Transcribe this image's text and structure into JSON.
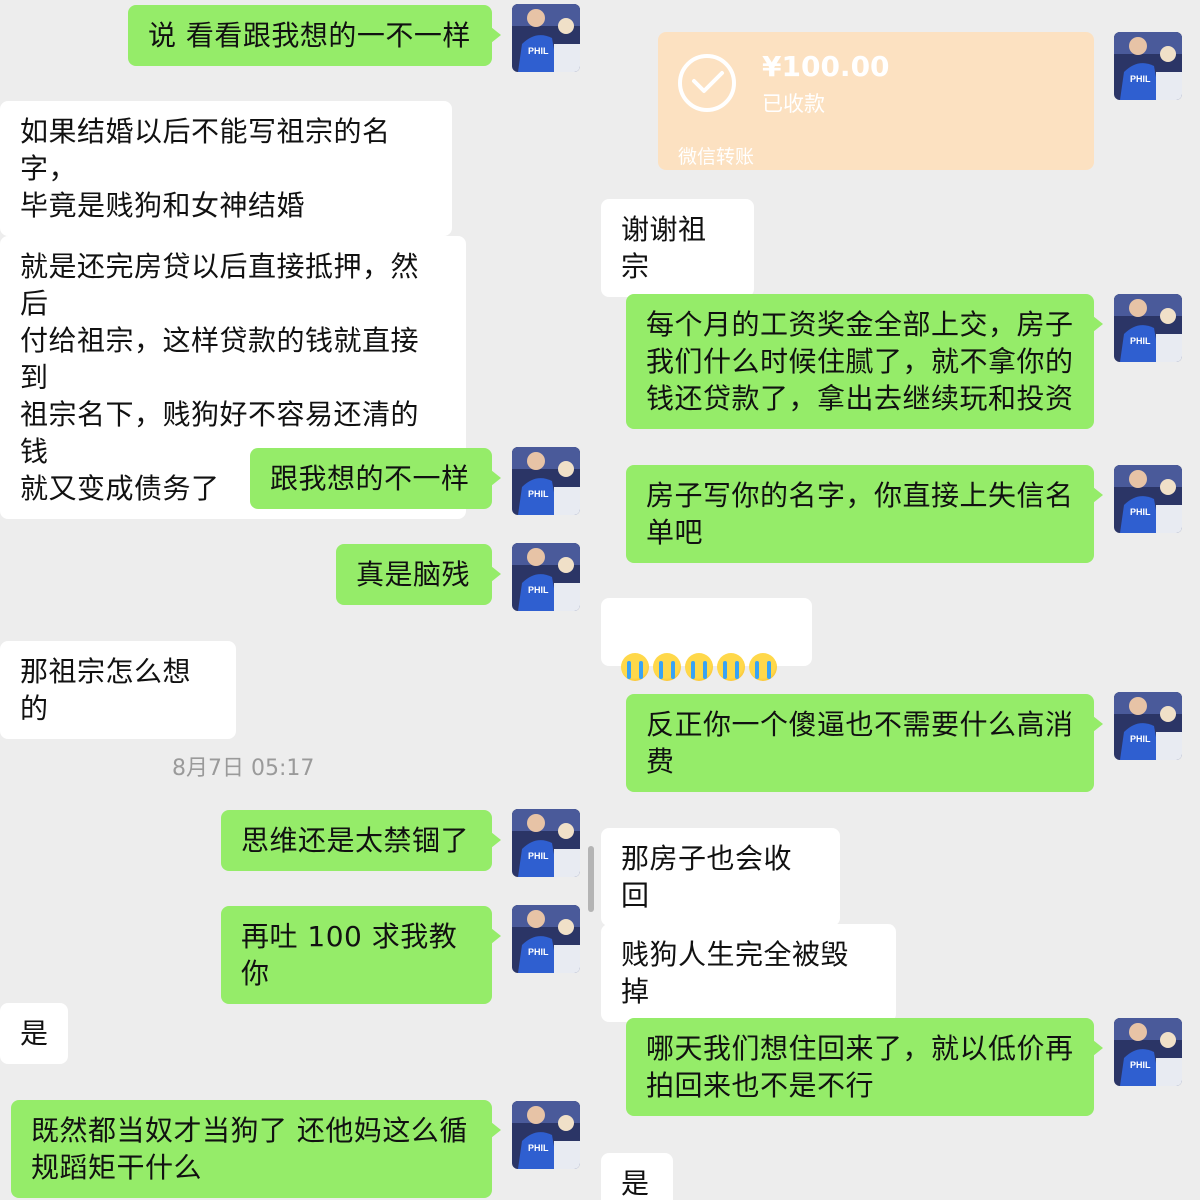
{
  "left": {
    "messages": [
      {
        "side": "sent",
        "text": "说 看看跟我想的一不一样"
      },
      {
        "side": "received",
        "text": "如果结婚以后不能写祖宗的名字，\n毕竟是贱狗和女神结婚"
      },
      {
        "side": "received",
        "text": "就是还完房贷以后直接抵押，然后\n付给祖宗，这样贷款的钱就直接到\n祖宗名下，贱狗好不容易还清的钱\n就又变成债务了"
      },
      {
        "side": "sent",
        "text": "跟我想的不一样"
      },
      {
        "side": "sent",
        "text": "真是脑残"
      },
      {
        "side": "received",
        "text": "那祖宗怎么想的"
      },
      {
        "side": "sent",
        "text": "思维还是太禁锢了"
      },
      {
        "side": "sent",
        "text": "再吐 100 求我教你"
      },
      {
        "side": "received",
        "text": "是"
      },
      {
        "side": "sent",
        "text": "既然都当奴才当狗了 还他妈这么循\n规蹈矩干什么"
      }
    ],
    "timestamp": "8月7日 05:17"
  },
  "right": {
    "transfer": {
      "amount": "¥100.00",
      "status": "已收款",
      "footer": "微信转账"
    },
    "messages": [
      {
        "side": "received",
        "text": "谢谢祖宗"
      },
      {
        "side": "sent",
        "text": "每个月的工资奖金全部上交，房子\n我们什么时候住腻了，就不拿你的\n钱还贷款了，拿出去继续玩和投资"
      },
      {
        "side": "sent",
        "text": "房子写你的名字，你直接上失信名\n单吧"
      },
      {
        "side": "received",
        "text": "loudly-crying-emoji x5",
        "emoji_count": 5
      },
      {
        "side": "sent",
        "text": "反正你一个傻逼也不需要什么高消\n费"
      },
      {
        "side": "received",
        "text": "那房子也会收回"
      },
      {
        "side": "received",
        "text": "贱狗人生完全被毁掉"
      },
      {
        "side": "sent",
        "text": "哪天我们想住回来了，就以低价再\n拍回来也不是不行"
      },
      {
        "side": "received",
        "text": "是"
      }
    ]
  },
  "colors": {
    "background": "#ededed",
    "sent_bubble": "#95ec69",
    "received_bubble": "#ffffff",
    "transfer_card": "#fce1c1"
  }
}
